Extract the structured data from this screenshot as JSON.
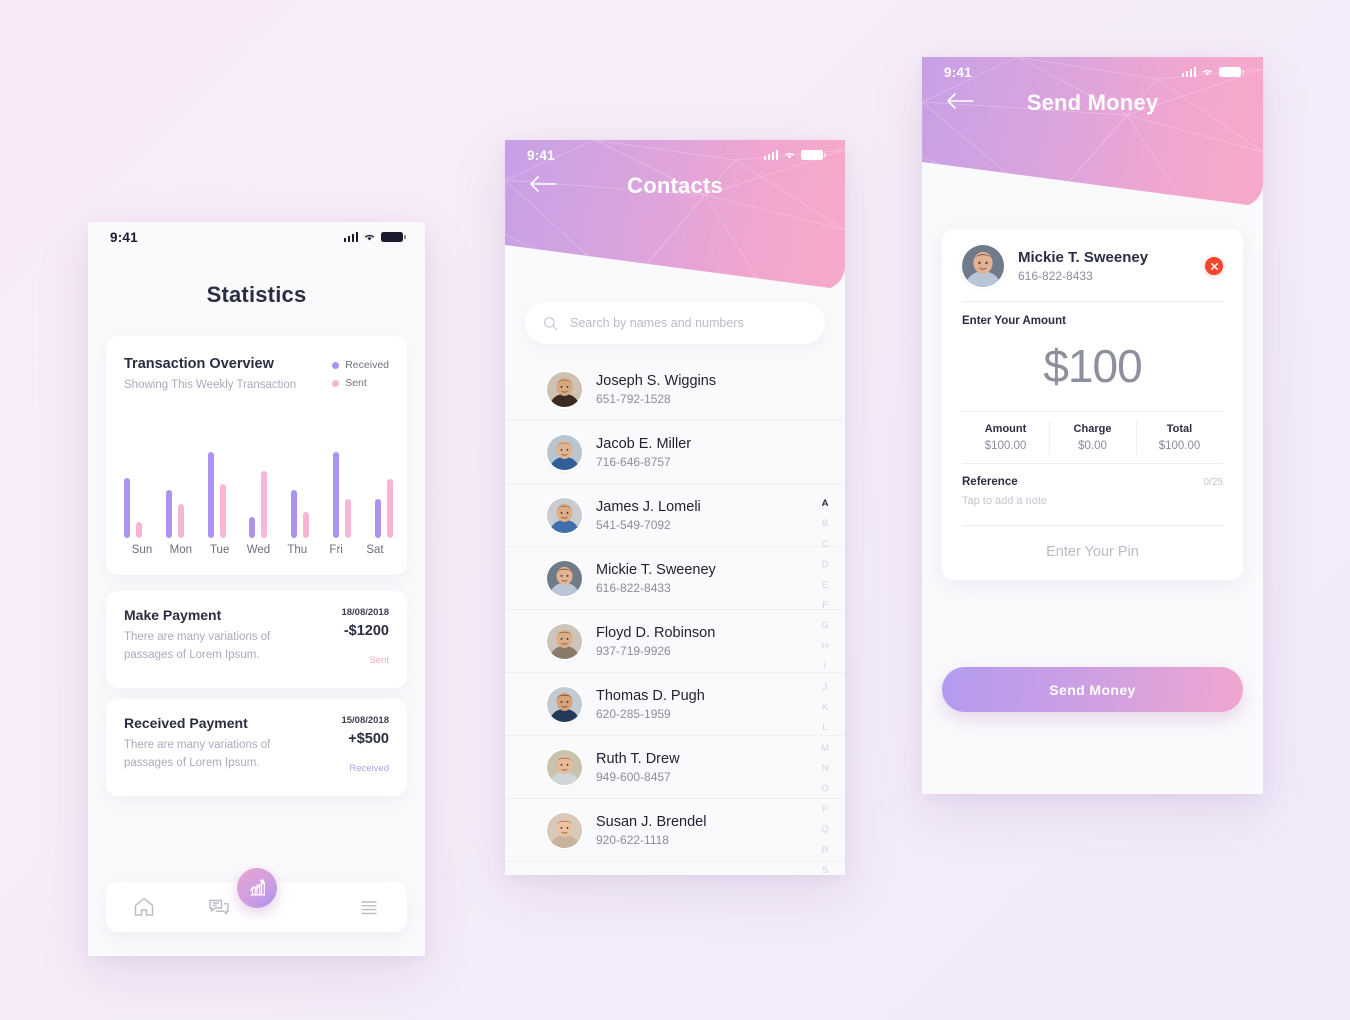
{
  "theme": {
    "bg": "#f7ecf8",
    "purple": "#ab93ef",
    "pink": "#f9b6d4",
    "ink": "#2b2d42",
    "muted": "#a9abbd",
    "grad_from": "#c7a0e6",
    "grad_to": "#f7a9ca",
    "danger": "#f5462d"
  },
  "statusbar": {
    "time": "9:41"
  },
  "statistics": {
    "title": "Statistics",
    "chart_card": {
      "title": "Transaction Overview",
      "subtitle": "Showing This Weekly Transaction",
      "legend": [
        {
          "label": "Received",
          "color": "#ab93ef"
        },
        {
          "label": "Sent",
          "color": "#f9b6d4"
        }
      ]
    },
    "transactions": [
      {
        "name": "Make Payment",
        "desc": "There are many variations of passages of Lorem Ipsum.",
        "date": "18/08/2018",
        "amount": "-$1200",
        "status": "Sent",
        "status_color": "#f7a6c4"
      },
      {
        "name": "Received Payment",
        "desc": "There are many variations of passages of Lorem Ipsum.",
        "date": "15/08/2018",
        "amount": "+$500",
        "status": "Received",
        "status_color": "#b3a0ef"
      }
    ],
    "tabbar": [
      {
        "icon": "home-icon",
        "active": false
      },
      {
        "icon": "chat-icon",
        "active": false
      },
      {
        "icon": "stats-chart-icon",
        "active": true
      },
      {
        "icon": "menu-icon",
        "active": false
      }
    ]
  },
  "chart_data": {
    "type": "bar",
    "title": "Transaction Overview",
    "subtitle": "Showing This Weekly Transaction",
    "categories": [
      "Sun",
      "Mon",
      "Tue",
      "Wed",
      "Thu",
      "Fri",
      "Sat"
    ],
    "series": [
      {
        "name": "Received",
        "color": "#ab93ef",
        "values": [
          63,
          50,
          90,
          22,
          50,
          90,
          41
        ]
      },
      {
        "name": "Sent",
        "color": "#f9b6d4",
        "values": [
          17,
          35,
          56,
          70,
          27,
          41,
          61
        ]
      }
    ],
    "ylim": [
      0,
      100
    ],
    "xlabel": "",
    "ylabel": "",
    "grid": false,
    "legend_position": "top-right"
  },
  "contacts": {
    "header_title": "Contacts",
    "back_icon": "back-arrow-icon",
    "search": {
      "placeholder": "Search by names and numbers",
      "value": "",
      "icon": "search-icon"
    },
    "list": [
      {
        "name": "Joseph S. Wiggins",
        "phone": "651-792-1528",
        "avatar": "man-beard"
      },
      {
        "name": "Jacob E. Miller",
        "phone": "716-646-8757",
        "avatar": "man-bald"
      },
      {
        "name": "James J. Lomeli",
        "phone": "541-549-7092",
        "avatar": "man-glasses"
      },
      {
        "name": "Mickie T. Sweeney",
        "phone": "616-822-8433",
        "avatar": "woman-dark"
      },
      {
        "name": "Floyd D. Robinson",
        "phone": "937-719-9926",
        "avatar": "man-long-hair"
      },
      {
        "name": "Thomas D. Pugh",
        "phone": "620-285-1959",
        "avatar": "man-suit"
      },
      {
        "name": "Ruth T. Drew",
        "phone": "949-600-8457",
        "avatar": "woman-brown"
      },
      {
        "name": "Susan J. Brendel",
        "phone": "920-622-1118",
        "avatar": "woman-red"
      }
    ],
    "alpha_index": [
      "A",
      "B",
      "C",
      "D",
      "E",
      "F",
      "G",
      "H",
      "I",
      "J",
      "K",
      "L",
      "M",
      "N",
      "O",
      "P",
      "Q",
      "R",
      "S"
    ],
    "alpha_active": "A"
  },
  "send_money": {
    "header_title": "Send Money",
    "back_icon": "back-arrow-icon",
    "recipient": {
      "name": "Mickie T. Sweeney",
      "phone": "616-822-8433",
      "avatar": "woman-dark"
    },
    "close_icon": "close-circle-icon",
    "amount_label": "Enter Your Amount",
    "amount_value": "$100",
    "totals": [
      {
        "label": "Amount",
        "value": "$100.00"
      },
      {
        "label": "Charge",
        "value": "$0.00"
      },
      {
        "label": "Total",
        "value": "$100.00"
      }
    ],
    "reference_label": "Reference",
    "reference_counter": "0/25",
    "reference_placeholder": "Tap to add a note",
    "pin_placeholder": "Enter Your Pin",
    "submit_label": "Send Money"
  }
}
